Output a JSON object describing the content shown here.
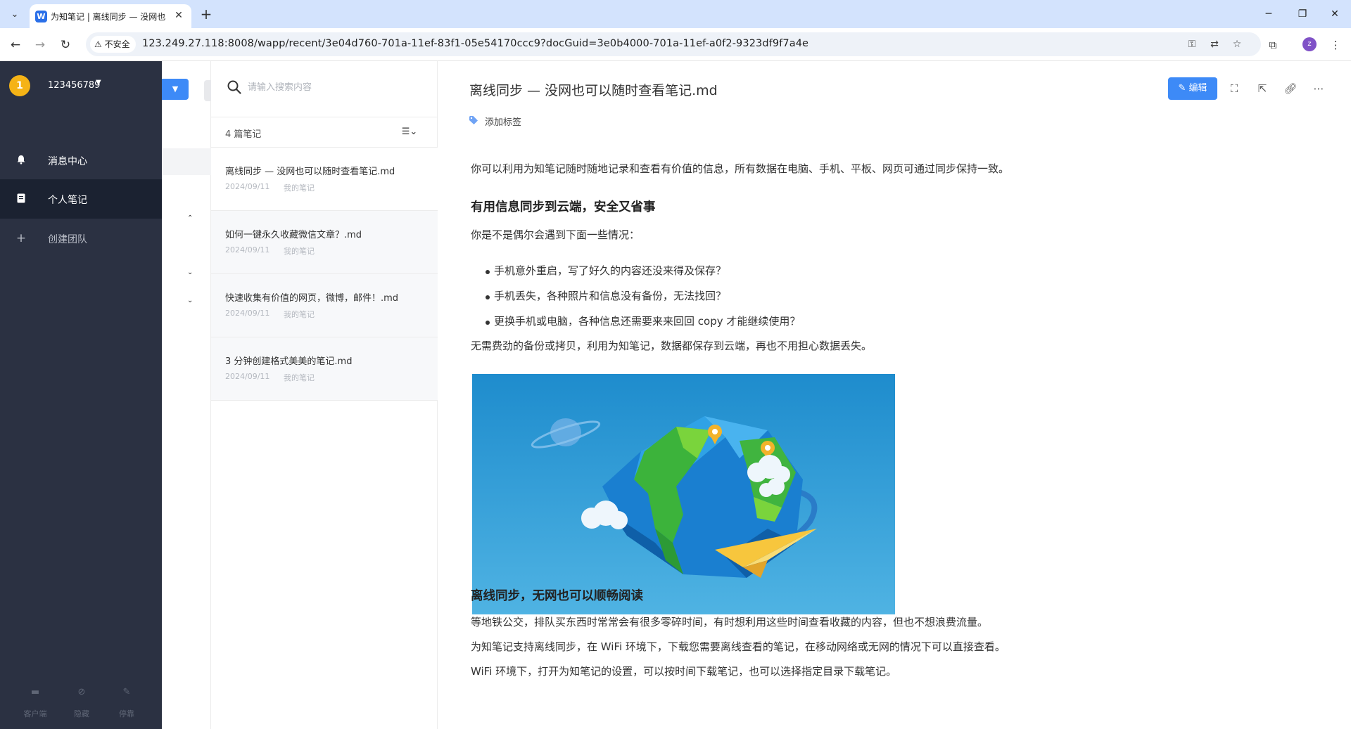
{
  "browser": {
    "tab_title": "为知笔记 | 离线同步 — 没网也",
    "favicon_letter": "W",
    "insecure_label": "不安全",
    "url": "123.249.27.118:8008/wapp/recent/3e04d760-701a-11ef-83f1-05e54170ccc9?docGuid=3e0b4000-701a-11ef-a0f2-9323df9f7a4e",
    "profile_initial": "z"
  },
  "sidebar": {
    "avatar_text": "1",
    "username": "123456789",
    "items": [
      {
        "label": "消息中心",
        "icon": "bell-icon"
      },
      {
        "label": "个人笔记",
        "icon": "note-icon"
      },
      {
        "label": "创建团队",
        "icon": "plus-icon"
      }
    ],
    "bottom": [
      {
        "label": "客户端",
        "icon": "desktop-icon"
      },
      {
        "label": "隐藏",
        "icon": "eye-off-icon"
      },
      {
        "label": "停靠",
        "icon": "pin-icon"
      }
    ]
  },
  "notelist": {
    "search_placeholder": "请输入搜索内容",
    "count_label": "4 篇笔记",
    "notes": [
      {
        "title": "离线同步 — 没网也可以随时查看笔记.md",
        "date": "2024/09/11",
        "folder": "我的笔记"
      },
      {
        "title": "如何一键永久收藏微信文章？.md",
        "date": "2024/09/11",
        "folder": "我的笔记"
      },
      {
        "title": "快速收集有价值的网页，微博，邮件！.md",
        "date": "2024/09/11",
        "folder": "我的笔记"
      },
      {
        "title": "3 分钟创建格式美美的笔记.md",
        "date": "2024/09/11",
        "folder": "我的笔记"
      }
    ]
  },
  "document": {
    "title": "离线同步 — 没网也可以随时查看笔记.md",
    "edit_label": "编辑",
    "add_tag_label": "添加标签",
    "intro": "你可以利用为知笔记随时随地记录和查看有价值的信息，所有数据在电脑、手机、平板、网页可通过同步保持一致。",
    "h1": "有用信息同步到云端，安全又省事",
    "q": "你是不是偶尔会遇到下面一些情况：",
    "bullets": [
      "手机意外重启，写了好久的内容还没来得及保存？",
      "手机丢失，各种照片和信息没有备份，无法找回？",
      "更换手机或电脑，各种信息还需要来来回回 copy 才能继续使用？"
    ],
    "p2": "无需费劲的备份或拷贝，利用为知笔记，数据都保存到云端，再也不用担心数据丢失。",
    "h2": "离线同步，无网也可以顺畅阅读",
    "p3": "等地铁公交，排队买东西时常常会有很多零碎时间，有时想利用这些时间查看收藏的内容，但也不想浪费流量。",
    "p4": "为知笔记支持离线同步，在 WiFi 环境下，下载您需要离线查看的笔记，在移动网络或无网的情况下可以直接查看。",
    "p5": "WiFi 环境下，打开为知笔记的设置，可以按时间下载笔记，也可以选择指定目录下载笔记。"
  },
  "colors": {
    "sidebar_bg": "#2b3142",
    "sidebar_active": "#1b2231",
    "accent": "#3d8af7",
    "avatar": "#f5b316"
  }
}
